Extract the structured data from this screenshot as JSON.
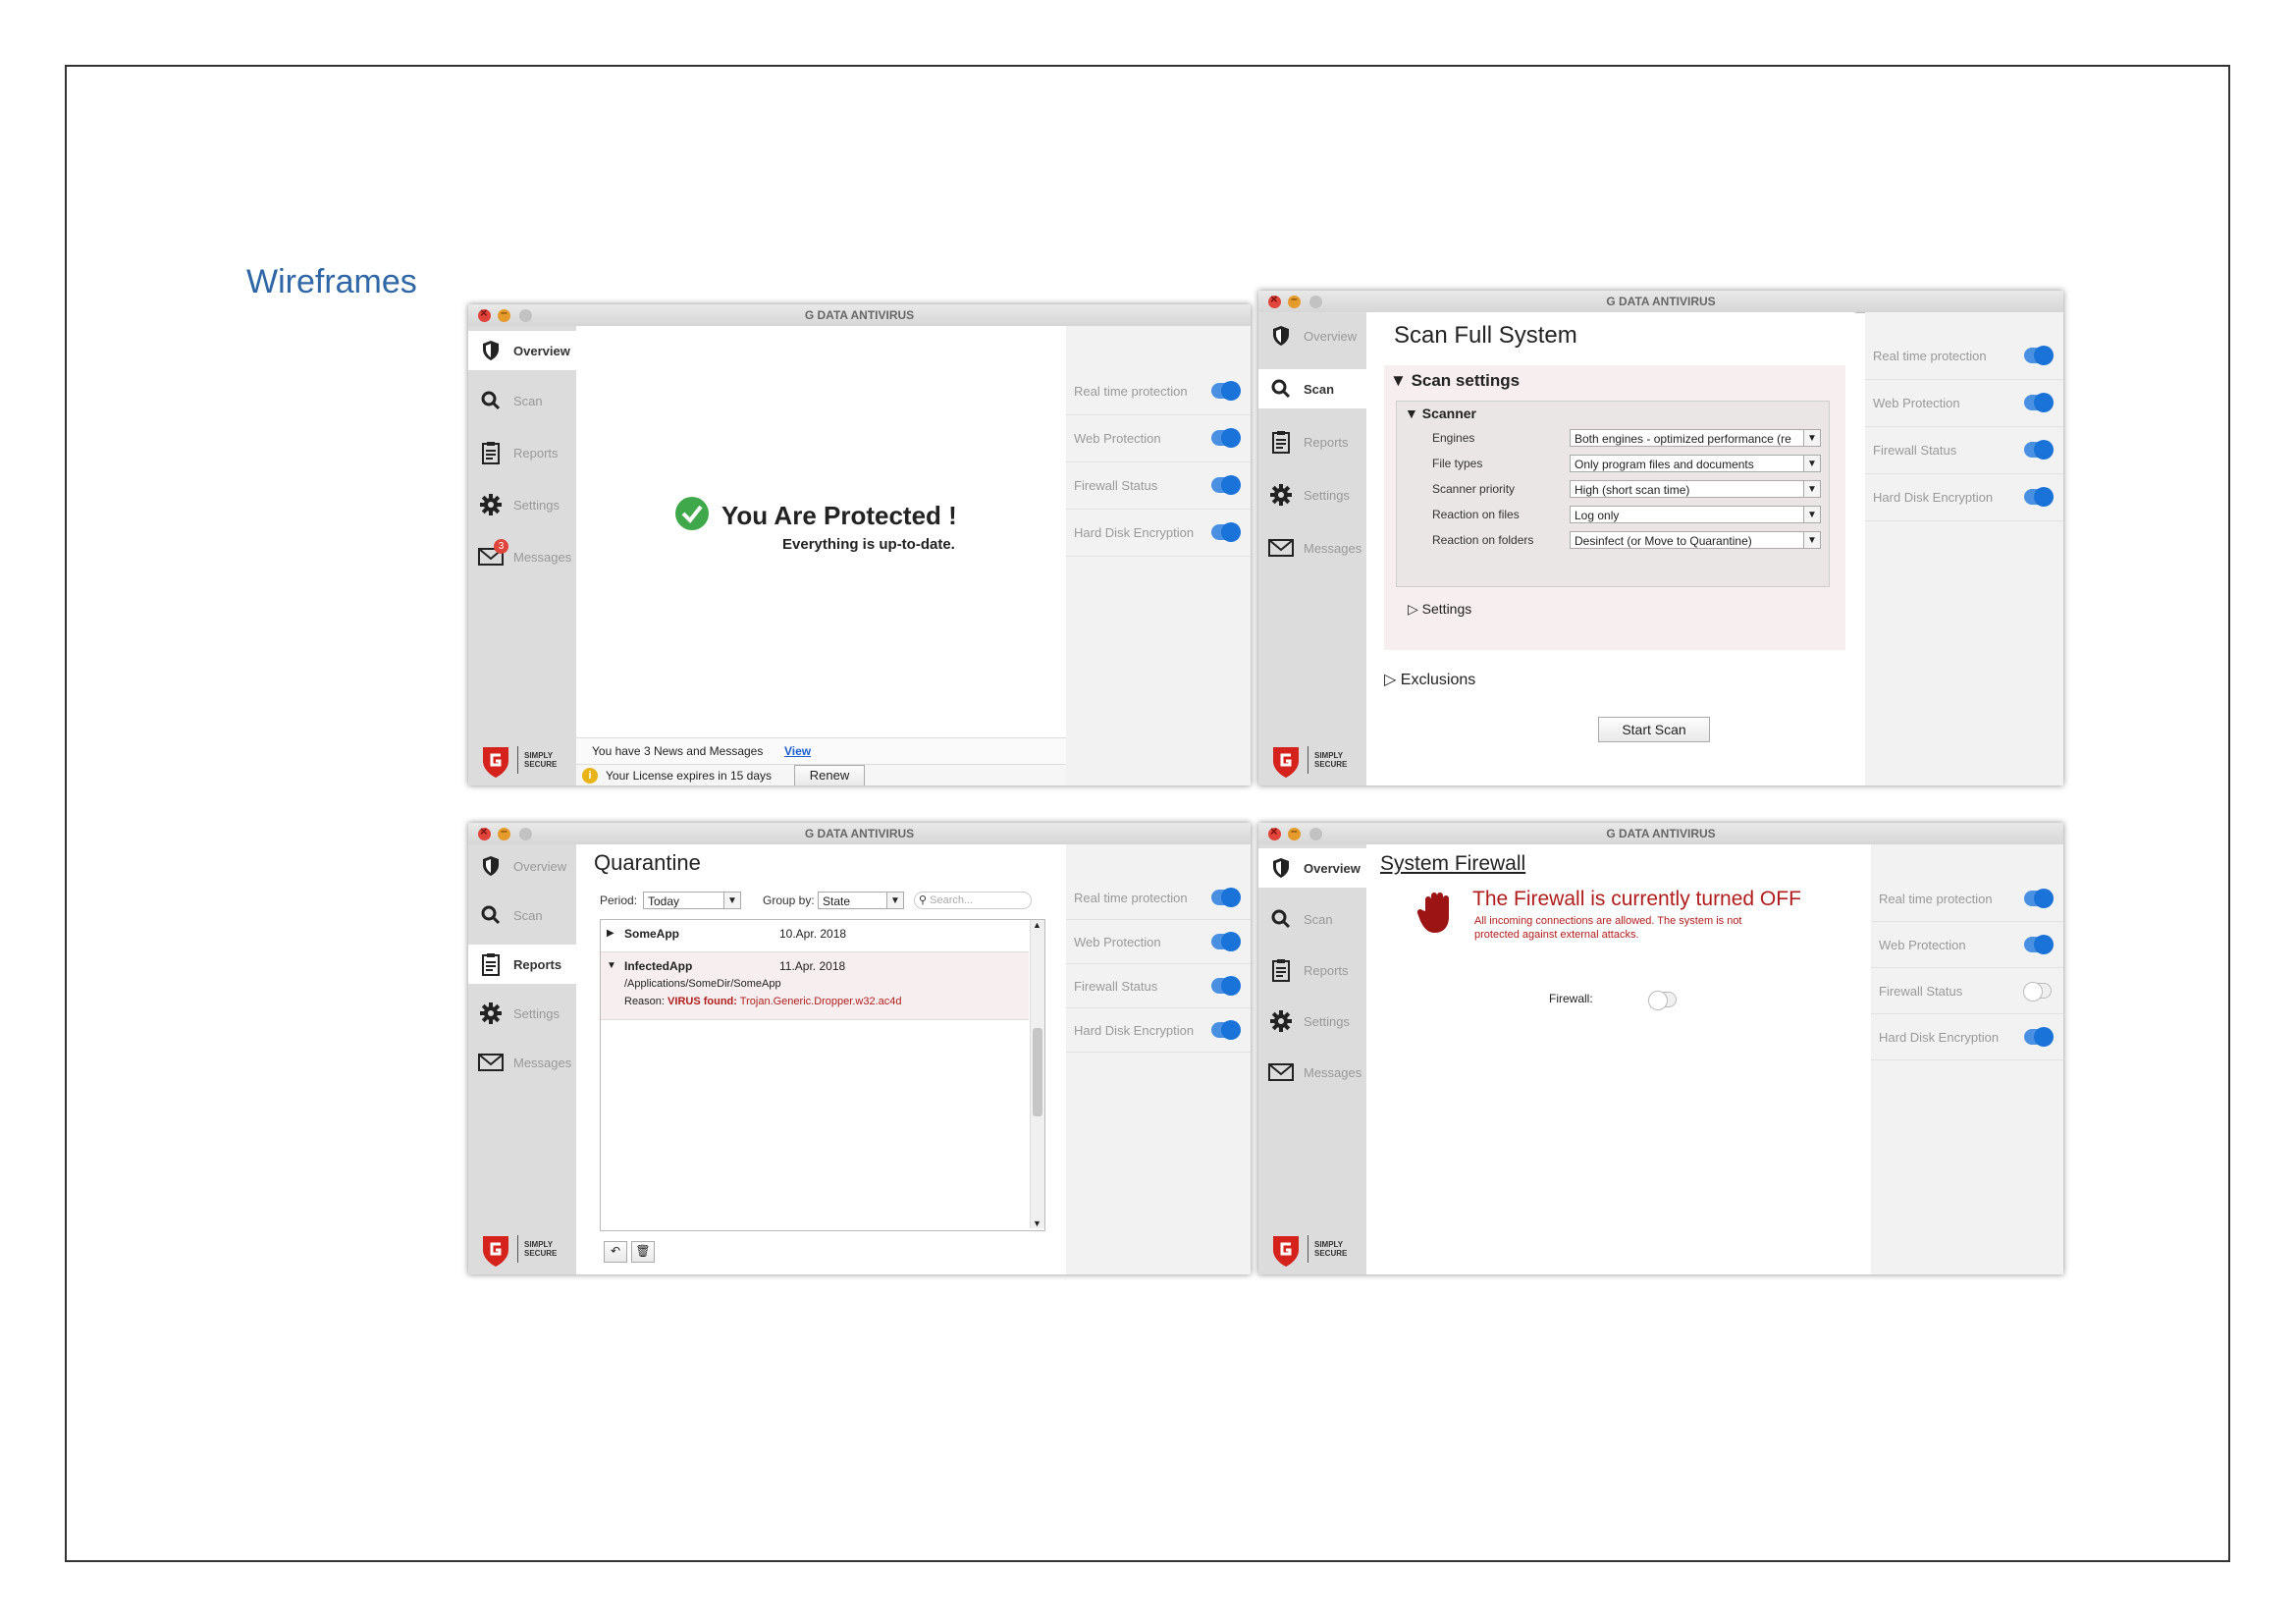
{
  "page": {
    "heading": "Wireframes"
  },
  "app": {
    "title": "G DATA ANTIVIRUS"
  },
  "nav": {
    "overview": "Overview",
    "scan": "Scan",
    "reports": "Reports",
    "settings": "Settings",
    "messages": "Messages",
    "messages_badge": "3"
  },
  "logo": {
    "brand": "G DATA",
    "tagline1": "SIMPLY",
    "tagline2": "SECURE"
  },
  "status": {
    "realtime": "Real time protection",
    "web": "Web Protection",
    "firewall": "Firewall Status",
    "disk": "Hard Disk Encryption"
  },
  "overview": {
    "title": "You Are Protected !",
    "subtitle": "Everything is up-to-date.",
    "news": "You have 3 News and Messages",
    "view_link": "View",
    "license": "Your License expires in 15 days",
    "renew": "Renew"
  },
  "scan": {
    "title": "Scan Full System",
    "section": "Scan settings",
    "scanner": "Scanner",
    "rows": [
      {
        "label": "Engines",
        "value": "Both engines - optimized performance (re"
      },
      {
        "label": "File types",
        "value": "Only program files and documents"
      },
      {
        "label": "Scanner priority",
        "value": "High (short scan time)"
      },
      {
        "label": "Reaction on files",
        "value": "Log only"
      },
      {
        "label": "Reaction on folders",
        "value": "Desinfect (or Move to Quarantine)"
      }
    ],
    "settings": "Settings",
    "exclusions": "Exclusions",
    "start": "Start Scan"
  },
  "quarantine": {
    "title": "Quarantine",
    "period_label": "Period:",
    "period_value": "Today",
    "group_label": "Group by:",
    "group_value": "State",
    "search_placeholder": "Search...",
    "items": [
      {
        "name": "SomeApp",
        "date": "10.Apr. 2018"
      },
      {
        "name": "InfectedApp",
        "date": "11.Apr. 2018",
        "path": "/Applications/SomeDir/SomeApp",
        "reason_label": "Reason:",
        "reason_type": "VIRUS found:",
        "reason_value": "Trojan.Generic.Dropper.w32.ac4d"
      }
    ]
  },
  "firewall": {
    "title": "System Firewall",
    "headline": "The Firewall is currently turned OFF",
    "desc1": "All incoming connections are allowed. The system is not",
    "desc2": "protected against external attacks.",
    "label": "Firewall:"
  },
  "colors": {
    "accent": "#1a73d9",
    "danger": "#b11d1d",
    "heading": "#2e66a6"
  }
}
